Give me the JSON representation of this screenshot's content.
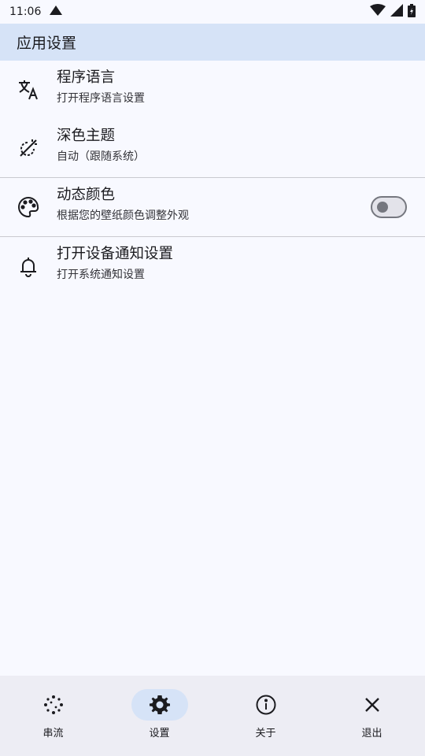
{
  "status": {
    "time": "11:06"
  },
  "appbar": {
    "title": "应用设置"
  },
  "settings": [
    {
      "title": "程序语言",
      "subtitle": "打开程序语言设置",
      "icon": "translate-icon"
    },
    {
      "title": "深色主题",
      "subtitle": "自动（跟随系统）",
      "icon": "dark-theme-icon"
    },
    {
      "title": "动态颜色",
      "subtitle": "根据您的壁纸颜色调整外观",
      "icon": "palette-icon",
      "toggle": false
    },
    {
      "title": "打开设备通知设置",
      "subtitle": "打开系统通知设置",
      "icon": "bell-icon"
    }
  ],
  "nav": [
    {
      "label": "串流",
      "icon": "stream-icon",
      "active": false
    },
    {
      "label": "设置",
      "icon": "gear-icon",
      "active": true
    },
    {
      "label": "关于",
      "icon": "info-icon",
      "active": false
    },
    {
      "label": "退出",
      "icon": "close-icon",
      "active": false
    }
  ],
  "colors": {
    "appbar_bg": "#d6e3f7",
    "page_bg": "#f8f9ff",
    "nav_bg": "#ededf4",
    "active_pill": "#d6e3f7"
  }
}
